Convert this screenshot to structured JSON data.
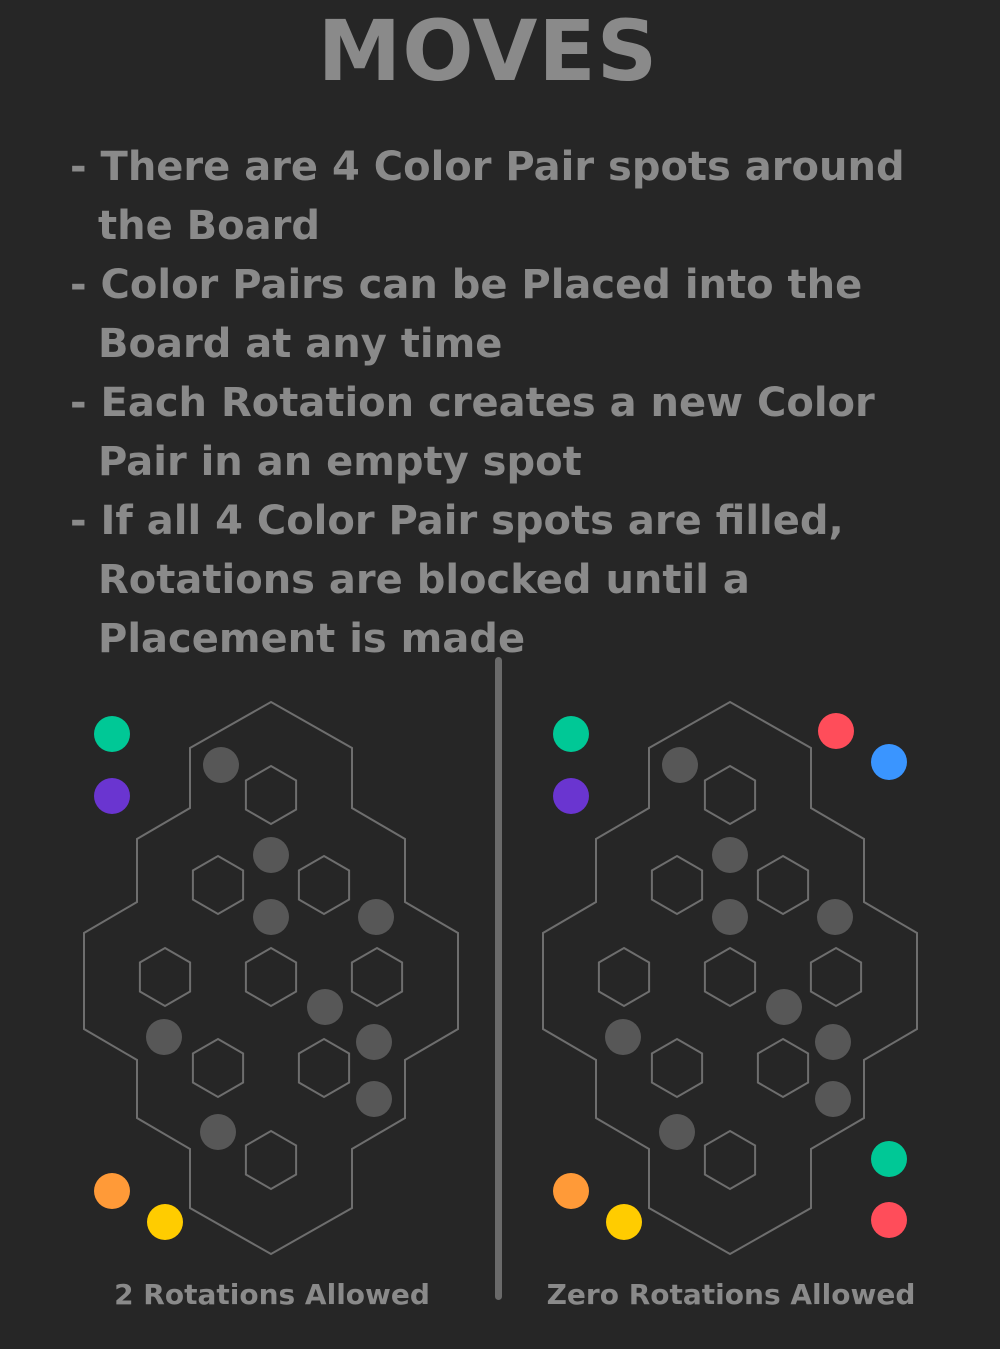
{
  "title": "MOVES",
  "rules": [
    "- There are 4 Color Pair spots around the Board",
    "- Color Pairs can be Placed into the Board at any time",
    "- Each Rotation creates a new Color Pair in an empty spot",
    "- If all 4 Color Pair spots are filled, Rotations are blocked until a Placement is made"
  ],
  "boards": [
    {
      "caption": "2 Rotations Allowed",
      "color_pairs": [
        {
          "spot": "top-left",
          "colors": [
            "#00c896",
            "#6a35d0"
          ]
        },
        {
          "spot": "bottom-left",
          "colors": [
            "#ff9a38",
            "#ffcc00"
          ]
        }
      ]
    },
    {
      "caption": "Zero Rotations Allowed",
      "color_pairs": [
        {
          "spot": "top-left",
          "colors": [
            "#00c896",
            "#6a35d0"
          ]
        },
        {
          "spot": "top-right",
          "colors": [
            "#ff4d5a",
            "#3a95ff"
          ]
        },
        {
          "spot": "bottom-left",
          "colors": [
            "#ff9a38",
            "#ffcc00"
          ]
        },
        {
          "spot": "bottom-right",
          "colors": [
            "#00c896",
            "#ff4d5a"
          ]
        }
      ]
    }
  ],
  "colors": {
    "background": "#262626",
    "text": "#8a8a8a",
    "board_outline": "#6e6e6e",
    "board_marker": "#575757"
  }
}
